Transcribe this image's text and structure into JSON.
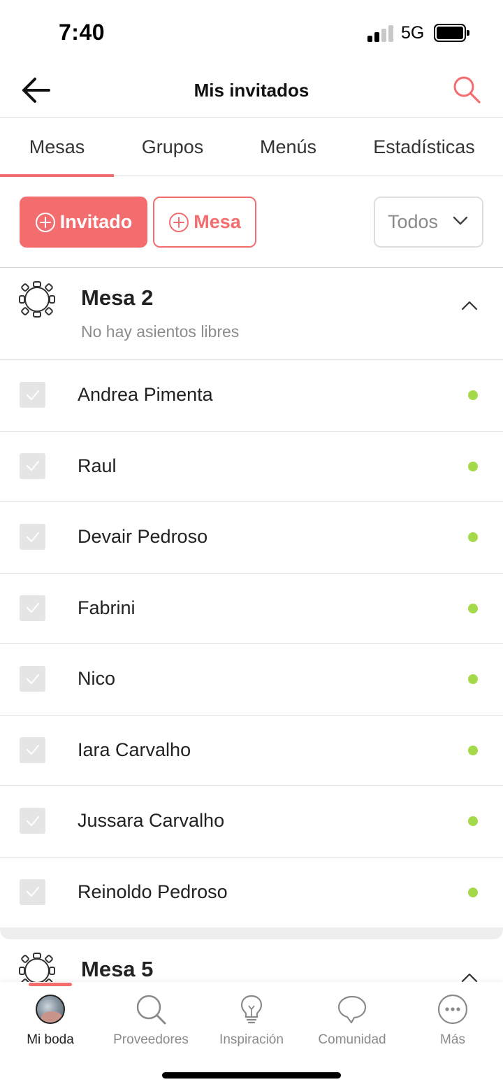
{
  "status_bar": {
    "time": "7:40",
    "network": "5G"
  },
  "header": {
    "title": "Mis invitados"
  },
  "tabs": [
    {
      "label": "Mesas",
      "active": true
    },
    {
      "label": "Grupos",
      "active": false
    },
    {
      "label": "Menús",
      "active": false
    },
    {
      "label": "Estadísticas",
      "active": false
    }
  ],
  "actions": {
    "add_guest_label": "Invitado",
    "add_table_label": "Mesa",
    "filter_value": "Todos"
  },
  "tables": [
    {
      "name": "Mesa 2",
      "subtitle": "No hay asientos libres",
      "guests": [
        {
          "name": "Andrea Pimenta"
        },
        {
          "name": "Raul"
        },
        {
          "name": "Devair Pedroso"
        },
        {
          "name": "Fabrini"
        },
        {
          "name": "Nico"
        },
        {
          "name": "Iara Carvalho"
        },
        {
          "name": "Jussara Carvalho"
        },
        {
          "name": "Reinoldo Pedroso"
        }
      ]
    },
    {
      "name": "Mesa 5"
    }
  ],
  "bottom_nav": [
    {
      "label": "Mi boda",
      "icon": "avatar",
      "active": true
    },
    {
      "label": "Proveedores",
      "icon": "search-icon",
      "active": false
    },
    {
      "label": "Inspiración",
      "icon": "lightbulb-icon",
      "active": false
    },
    {
      "label": "Comunidad",
      "icon": "chat-bubble-icon",
      "active": false
    },
    {
      "label": "Más",
      "icon": "more-icon",
      "active": false
    }
  ],
  "colors": {
    "accent": "#f36d6f",
    "confirmed_dot": "#a4d94a",
    "muted_text": "#8c8c8c"
  }
}
